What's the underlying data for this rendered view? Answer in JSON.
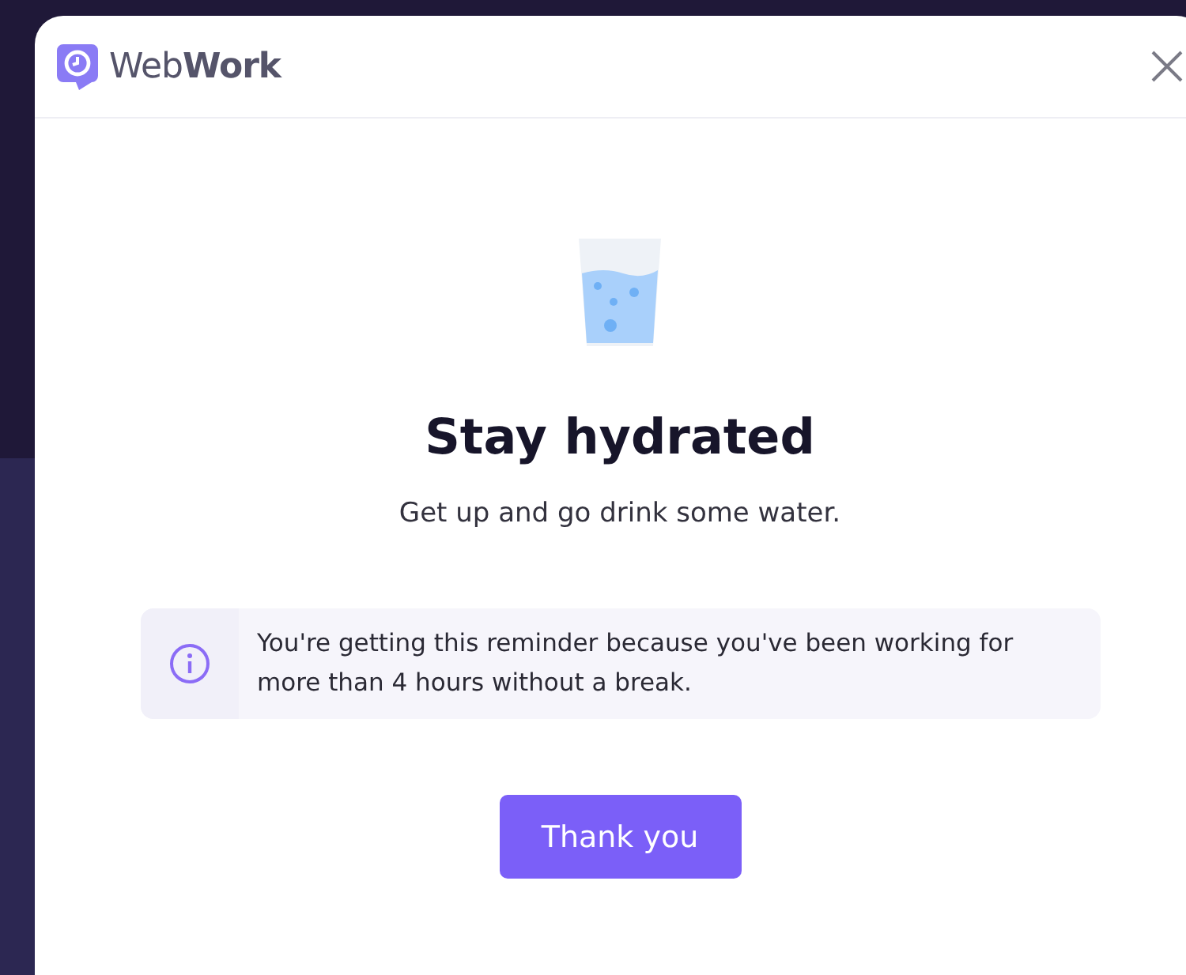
{
  "window": {
    "logo_text": "Web**Work**"
  },
  "reminder": {
    "title": "Stay hydrated",
    "message": "Get up and go drink some water.",
    "info": "You're getting this reminder because you've been working for more than 4 hours without a break."
  },
  "buttons": [
    "Thank you"
  ]
}
